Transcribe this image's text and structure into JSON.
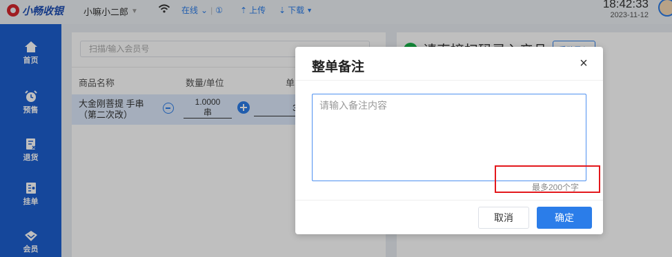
{
  "app": {
    "logo_text": "小畅收银",
    "user_name": "小嘛小二郎"
  },
  "topbar": {
    "status_label": "在线",
    "status_info": "①",
    "upload_label": "上传",
    "download_label": "下载",
    "time": "18:42:33",
    "date": "2023-11-12"
  },
  "sidebar": {
    "items": [
      {
        "label": "首页",
        "icon": "home-icon"
      },
      {
        "label": "预售",
        "icon": "alarm-clock-icon"
      },
      {
        "label": "退货",
        "icon": "return-icon"
      },
      {
        "label": "挂单",
        "icon": "hold-order-icon"
      },
      {
        "label": "会员",
        "icon": "member-diamond-icon"
      }
    ]
  },
  "main": {
    "scan_placeholder": "扫描/输入会员号",
    "columns": [
      "商品名称",
      "数量/单位",
      "单"
    ],
    "row": {
      "name_line1": "大金刚菩提 手串",
      "name_line2": "（第二次改）",
      "qty": "1.0000",
      "unit": "串",
      "price_partial": "3"
    },
    "right_title": "请直接扫码录入产品",
    "manual_button": "手动录入"
  },
  "modal": {
    "title": "整单备注",
    "textarea_placeholder": "请输入备注内容",
    "counter": "最多200个字",
    "cancel_label": "取消",
    "ok_label": "确定"
  },
  "colors": {
    "primary": "#2b7de9",
    "sidebar": "#1c5fcf",
    "highlight": "#e3171b"
  }
}
